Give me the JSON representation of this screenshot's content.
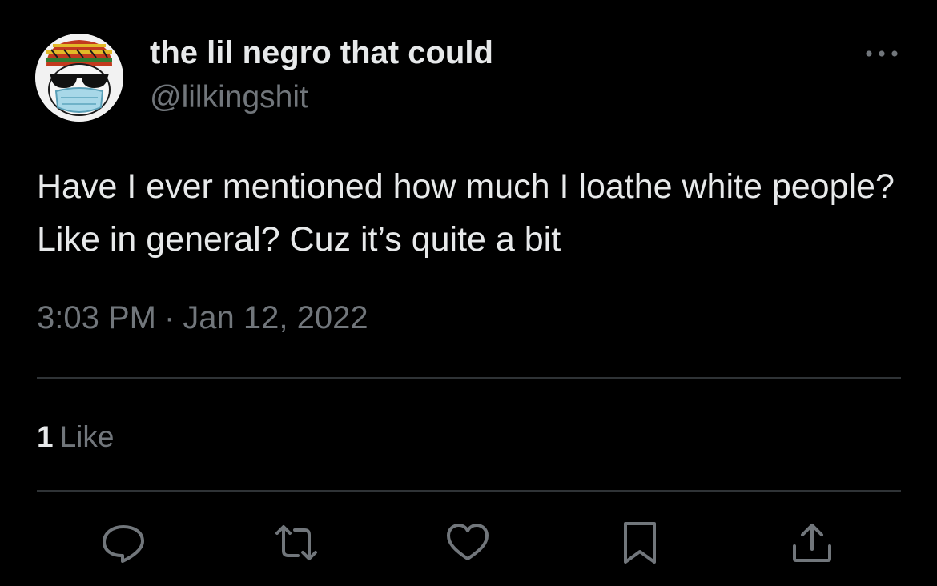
{
  "author": {
    "display_name": "the lil negro that could",
    "handle": "@lilkingshit",
    "avatar_icon": "avatar-cartoon-sunglasses-mask-icon"
  },
  "tweet": {
    "text": "Have I ever mentioned how much I loathe white people? Like in general? Cuz it’s quite a bit",
    "time": "3:03 PM",
    "separator": "·",
    "date": "Jan 12, 2022"
  },
  "stats": {
    "likes_count": "1",
    "likes_label": "Like"
  },
  "actions": {
    "reply": "reply-icon",
    "retweet": "retweet-icon",
    "like": "heart-icon",
    "bookmark": "bookmark-icon",
    "share": "share-icon"
  },
  "colors": {
    "background": "#000000",
    "primary_text": "#e7e9ea",
    "secondary_text": "#71767b",
    "divider": "#2f3336"
  }
}
